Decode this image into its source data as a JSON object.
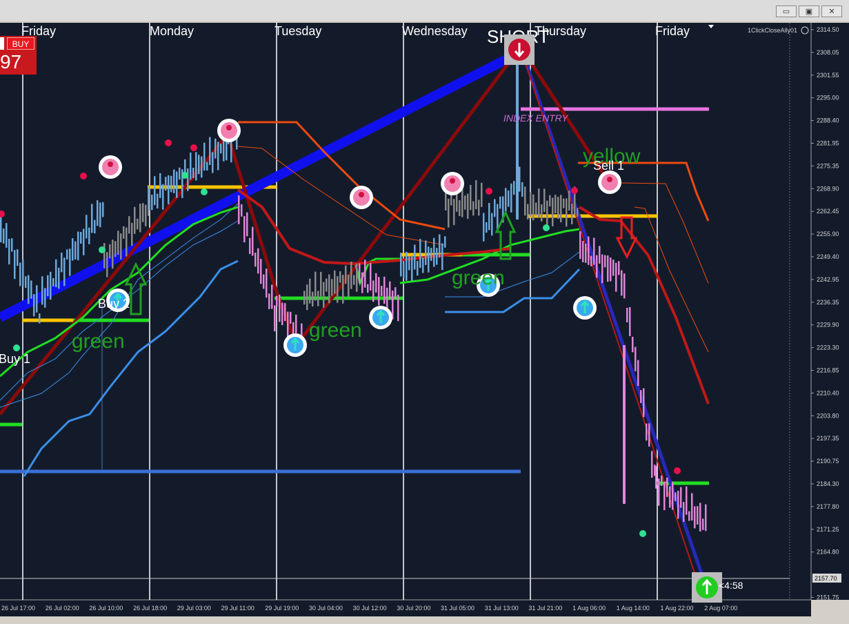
{
  "window": {
    "minimize": "▭",
    "restore": "▣",
    "close": "✕"
  },
  "trade_panel": {
    "buy_label": "BUY",
    "price": "97"
  },
  "chart": {
    "day_labels": [
      "Friday",
      "Monday",
      "Tuesday",
      "Wednesday",
      "Thursday",
      "Friday"
    ],
    "indicator_label": "1ClickCloseAlly01",
    "price_axis": [
      "2314.50",
      "2308.05",
      "2301.55",
      "2295.00",
      "2288.40",
      "2281.95",
      "2275.35",
      "2268.90",
      "2262.45",
      "2255.90",
      "2249.40",
      "2242.95",
      "2236.35",
      "2229.90",
      "2223.30",
      "2216.85",
      "2210.40",
      "2203.80",
      "2197.35",
      "2190.75",
      "2184.30",
      "2177.80",
      "2171.25",
      "2164.80",
      "2157.70",
      "2151.75"
    ],
    "current_price": "2157.70",
    "time_axis": [
      "26 Jul 17:00",
      "26 Jul 02:00",
      "26 Jul 10:00",
      "26 Jul 18:00",
      "29 Jul 03:00",
      "29 Jul 11:00",
      "29 Jul 19:00",
      "30 Jul 04:00",
      "30 Jul 12:00",
      "30 Jul 20:00",
      "31 Jul 05:00",
      "31 Jul 13:00",
      "31 Jul 21:00",
      "1 Aug 06:00",
      "1 Aug 14:00",
      "1 Aug 22:00",
      "2 Aug 07:00"
    ],
    "countdown": "<4:58"
  },
  "annotations": {
    "short": "SHORT",
    "index_entry": "INDEX ENTRY",
    "yellow": "yellow",
    "sell1": "Sell 1",
    "buy1": "Buy 1",
    "buy2": "Buy 2",
    "green1": "green",
    "green2": "green",
    "green3": "green"
  }
}
